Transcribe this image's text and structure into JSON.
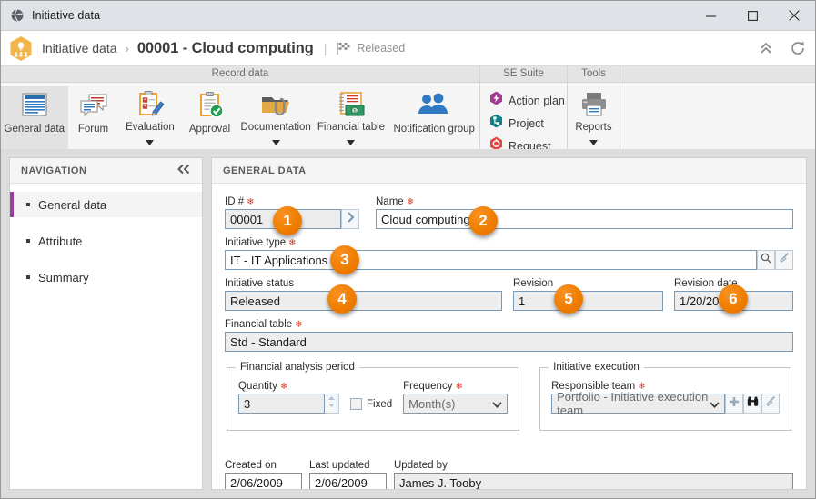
{
  "window": {
    "title": "Initiative data",
    "icon": "globe-icon",
    "minimize_label": "Minimize",
    "maximize_label": "Maximize",
    "close_label": "Close"
  },
  "header": {
    "app_icon": "initiative-hex-icon",
    "breadcrumb_root": "Initiative data",
    "breadcrumb_separator": "›",
    "breadcrumb_current": "00001 - Cloud computing",
    "divider": "|",
    "status_icon": "checkered-flag-icon",
    "status_text": "Released",
    "collapse_label": "Collapse ribbon",
    "refresh_label": "Refresh"
  },
  "ribbon": {
    "groups": [
      {
        "title": "Record data",
        "type": "buttons",
        "items": [
          {
            "label": "General data",
            "icon": "document-lines-icon",
            "active": true,
            "caret": false
          },
          {
            "label": "Forum",
            "icon": "chat-bubbles-icon",
            "active": false,
            "caret": false
          },
          {
            "label": "Evaluation",
            "icon": "clipboard-pen-icon",
            "active": false,
            "caret": true
          },
          {
            "label": "Approval",
            "icon": "clipboard-check-icon",
            "active": false,
            "caret": false
          },
          {
            "label": "Documentation",
            "icon": "folder-clip-icon",
            "active": false,
            "caret": true
          },
          {
            "label": "Financial table",
            "icon": "ledger-money-icon",
            "active": false,
            "caret": true
          },
          {
            "label": "Notification group",
            "icon": "people-group-icon",
            "active": false,
            "caret": false
          }
        ]
      },
      {
        "title": "SE Suite",
        "type": "list",
        "items": [
          {
            "label": "Action plan",
            "icon": "action-plan-hex-icon",
            "color": "#a23c8f"
          },
          {
            "label": "Project",
            "icon": "project-hex-icon",
            "color": "#0f8086"
          },
          {
            "label": "Request",
            "icon": "request-hex-icon",
            "color": "#e8433f"
          }
        ]
      },
      {
        "title": "Tools",
        "type": "buttons",
        "items": [
          {
            "label": "Reports",
            "icon": "printer-icon",
            "active": false,
            "caret": true
          }
        ]
      }
    ]
  },
  "navigation": {
    "title": "NAVIGATION",
    "collapse_icon": "double-chevron-left-icon",
    "items": [
      {
        "label": "General data",
        "active": true
      },
      {
        "label": "Attribute",
        "active": false
      },
      {
        "label": "Summary",
        "active": false
      }
    ]
  },
  "form": {
    "title": "GENERAL DATA",
    "fields": {
      "id": {
        "label": "ID #",
        "required": true,
        "value": "00001",
        "button_icon": "chevron-right-icon"
      },
      "name": {
        "label": "Name",
        "required": true,
        "value": "Cloud computing"
      },
      "initiative_type": {
        "label": "Initiative type",
        "required": true,
        "value": "IT - IT Applications",
        "buttons": [
          "search-icon",
          "broom-icon"
        ]
      },
      "initiative_status": {
        "label": "Initiative status",
        "required": false,
        "value": "Released"
      },
      "revision": {
        "label": "Revision",
        "required": false,
        "value": "1"
      },
      "revision_date": {
        "label": "Revision date",
        "required": false,
        "value": "1/20/2012"
      },
      "financial_table": {
        "label": "Financial table",
        "required": true,
        "value": "Std - Standard"
      }
    },
    "financial_analysis_period": {
      "legend": "Financial analysis period",
      "quantity": {
        "label": "Quantity",
        "required": true,
        "value": "3",
        "stepper_icon": "spinner-arrows-icon"
      },
      "fixed": {
        "label": "Fixed",
        "checked": false
      },
      "frequency": {
        "label": "Frequency",
        "required": true,
        "value": "Month(s)",
        "dropdown_icon": "chevron-down-icon"
      }
    },
    "initiative_execution": {
      "legend": "Initiative execution",
      "responsible_team": {
        "label": "Responsible team",
        "required": true,
        "value": "Portfolio - Initiative execution team",
        "dropdown_icon": "chevron-down-icon",
        "buttons": [
          "plus-icon",
          "binoculars-icon",
          "broom-icon"
        ]
      }
    },
    "audit": {
      "created_on": {
        "label": "Created on",
        "value": "2/06/2009"
      },
      "last_updated": {
        "label": "Last updated",
        "value": "2/06/2009"
      },
      "updated_by": {
        "label": "Updated by",
        "value": "James J. Tooby"
      }
    }
  },
  "callouts": [
    {
      "number": "1",
      "target": "id-field"
    },
    {
      "number": "2",
      "target": "name-field"
    },
    {
      "number": "3",
      "target": "initiative-type-field"
    },
    {
      "number": "4",
      "target": "initiative-status-field"
    },
    {
      "number": "5",
      "target": "revision-field"
    },
    {
      "number": "6",
      "target": "revision-date-field"
    }
  ],
  "colors": {
    "accent_orange": "#ef7d00",
    "nav_active": "#9b3fa0",
    "required_red": "#d83a27",
    "field_border": "#7a9ab8"
  }
}
